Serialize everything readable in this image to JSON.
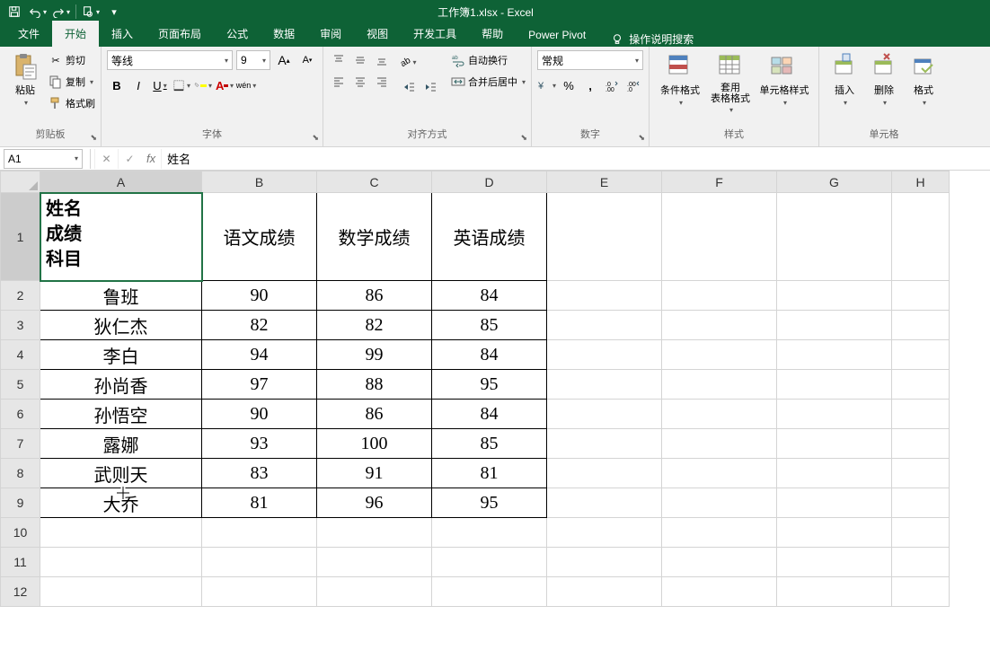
{
  "title": "工作簿1.xlsx - Excel",
  "tabs": [
    "文件",
    "开始",
    "插入",
    "页面布局",
    "公式",
    "数据",
    "审阅",
    "视图",
    "开发工具",
    "帮助",
    "Power Pivot"
  ],
  "tellme": "操作说明搜索",
  "clipboard": {
    "paste": "粘贴",
    "cut": "剪切",
    "copy": "复制",
    "painter": "格式刷",
    "group": "剪贴板"
  },
  "font": {
    "name": "等线",
    "size": "9",
    "group": "字体",
    "bold": "B",
    "italic": "I",
    "underline": "U",
    "wen": "wén"
  },
  "align": {
    "wrap": "自动换行",
    "merge": "合并后居中",
    "group": "对齐方式"
  },
  "number": {
    "format": "常规",
    "group": "数字"
  },
  "styles": {
    "cond": "条件格式",
    "table": "套用\n表格格式",
    "cell": "单元格样式",
    "group": "样式"
  },
  "cells": {
    "insert": "插入",
    "delete": "删除",
    "format": "格式",
    "group": "单元格"
  },
  "namebox": "A1",
  "formula": "姓名",
  "columns": [
    "A",
    "B",
    "C",
    "D",
    "E",
    "F",
    "G",
    "H"
  ],
  "row_nums": [
    1,
    2,
    3,
    4,
    5,
    6,
    7,
    8,
    9,
    10,
    11,
    12
  ],
  "a1_lines": [
    "姓名",
    "成绩",
    "科目"
  ],
  "headers": [
    "语文成绩",
    "数学成绩",
    "英语成绩"
  ],
  "rows": [
    {
      "name": "鲁班",
      "v": [
        90,
        86,
        84
      ]
    },
    {
      "name": "狄仁杰",
      "v": [
        82,
        82,
        85
      ]
    },
    {
      "name": "李白",
      "v": [
        94,
        99,
        84
      ]
    },
    {
      "name": "孙尚香",
      "v": [
        97,
        88,
        95
      ]
    },
    {
      "name": "孙悟空",
      "v": [
        90,
        86,
        84
      ]
    },
    {
      "name": "露娜",
      "v": [
        93,
        100,
        85
      ]
    },
    {
      "name": "武则天",
      "v": [
        83,
        91,
        81
      ]
    },
    {
      "name": "大乔",
      "v": [
        81,
        96,
        95
      ]
    }
  ],
  "chart_data": {
    "type": "table",
    "title": "",
    "columns": [
      "姓名",
      "语文成绩",
      "数学成绩",
      "英语成绩"
    ],
    "rows": [
      [
        "鲁班",
        90,
        86,
        84
      ],
      [
        "狄仁杰",
        82,
        82,
        85
      ],
      [
        "李白",
        94,
        99,
        84
      ],
      [
        "孙尚香",
        97,
        88,
        95
      ],
      [
        "孙悟空",
        90,
        86,
        84
      ],
      [
        "露娜",
        93,
        100,
        85
      ],
      [
        "武则天",
        83,
        91,
        81
      ],
      [
        "大乔",
        81,
        96,
        95
      ]
    ]
  }
}
